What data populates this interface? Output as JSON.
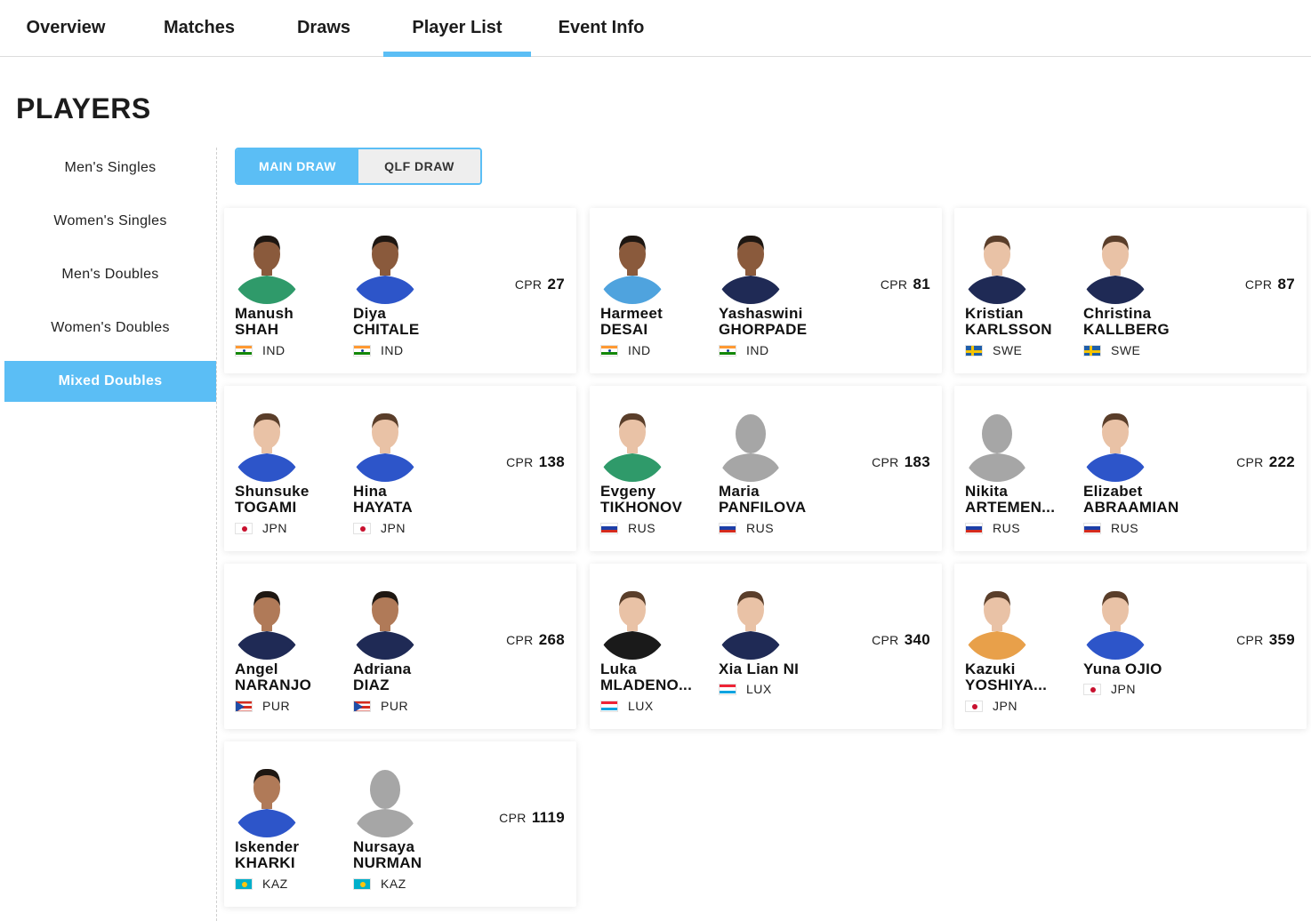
{
  "nav": {
    "tabs": [
      {
        "label": "Overview",
        "active": false
      },
      {
        "label": "Matches",
        "active": false
      },
      {
        "label": "Draws",
        "active": false
      },
      {
        "label": "Player List",
        "active": true
      },
      {
        "label": "Event Info",
        "active": false
      }
    ]
  },
  "page_title": "PLAYERS",
  "sidebar": {
    "items": [
      {
        "label": "Men's Singles",
        "active": false
      },
      {
        "label": "Women's Singles",
        "active": false
      },
      {
        "label": "Men's Doubles",
        "active": false
      },
      {
        "label": "Women's Doubles",
        "active": false
      },
      {
        "label": "Mixed Doubles",
        "active": true
      }
    ]
  },
  "draw_toggle": {
    "main_label": "MAIN DRAW",
    "qlf_label": "QLF DRAW",
    "selected": "MAIN DRAW"
  },
  "cpr_label": "CPR",
  "pairs": [
    {
      "cpr": "27",
      "players": [
        {
          "first": "Manush",
          "last": "SHAH",
          "country": "IND",
          "photo": "skin-dark-shirt-green"
        },
        {
          "first": "Diya",
          "last": "CHITALE",
          "country": "IND",
          "photo": "skin-dark-shirt-blue"
        }
      ]
    },
    {
      "cpr": "81",
      "players": [
        {
          "first": "Harmeet",
          "last": "DESAI",
          "country": "IND",
          "photo": "skin-dark-shirt-lightblue"
        },
        {
          "first": "Yashaswini",
          "last": "GHORPADE",
          "country": "IND",
          "photo": "skin-dark-shirt-navy"
        }
      ]
    },
    {
      "cpr": "87",
      "players": [
        {
          "first": "Kristian",
          "last": "KARLSSON",
          "country": "SWE",
          "photo": "skin-light-shirt-navy"
        },
        {
          "first": "Christina",
          "last": "KALLBERG",
          "country": "SWE",
          "photo": "skin-light-shirt-navy"
        }
      ]
    },
    {
      "cpr": "138",
      "players": [
        {
          "first": "Shunsuke",
          "last": "TOGAMI",
          "country": "JPN",
          "photo": "skin-light-shirt-blue"
        },
        {
          "first": "Hina",
          "last": "HAYATA",
          "country": "JPN",
          "photo": "skin-light-shirt-blue"
        }
      ]
    },
    {
      "cpr": "183",
      "players": [
        {
          "first": "Evgeny",
          "last": "TIKHONOV",
          "country": "RUS",
          "photo": "skin-light-shirt-green"
        },
        {
          "first": "Maria",
          "last": "PANFILOVA",
          "country": "RUS",
          "photo": "placeholder"
        }
      ]
    },
    {
      "cpr": "222",
      "players": [
        {
          "first": "Nikita",
          "last": "ARTEMEN...",
          "country": "RUS",
          "photo": "placeholder"
        },
        {
          "first": "Elizabet",
          "last": "ABRAAMIAN",
          "country": "RUS",
          "photo": "skin-light-shirt-blue"
        }
      ]
    },
    {
      "cpr": "268",
      "players": [
        {
          "first": "Angel",
          "last": "NARANJO",
          "country": "PUR",
          "photo": "skin-mid-shirt-navy"
        },
        {
          "first": "Adriana",
          "last": "DIAZ",
          "country": "PUR",
          "photo": "skin-mid-shirt-navy"
        }
      ]
    },
    {
      "cpr": "340",
      "players": [
        {
          "first": "Luka",
          "last": "MLADENO...",
          "country": "LUX",
          "photo": "skin-light-shirt-black"
        },
        {
          "first": "Xia Lian NI",
          "last": "",
          "country": "LUX",
          "photo": "skin-light-shirt-navy"
        }
      ]
    },
    {
      "cpr": "359",
      "players": [
        {
          "first": "Kazuki",
          "last": "YOSHIYA...",
          "country": "JPN",
          "photo": "skin-light-shirt-orange"
        },
        {
          "first": "Yuna OJIO",
          "last": "",
          "country": "JPN",
          "photo": "skin-light-shirt-blue"
        }
      ]
    },
    {
      "cpr": "1119",
      "players": [
        {
          "first": "Iskender",
          "last": "KHARKI",
          "country": "KAZ",
          "photo": "skin-mid-shirt-blue"
        },
        {
          "first": "Nursaya",
          "last": "NURMAN",
          "country": "KAZ",
          "photo": "placeholder"
        }
      ]
    }
  ],
  "colors": {
    "accent": "#5bbef5",
    "placeholder": "#a6a6a6"
  }
}
